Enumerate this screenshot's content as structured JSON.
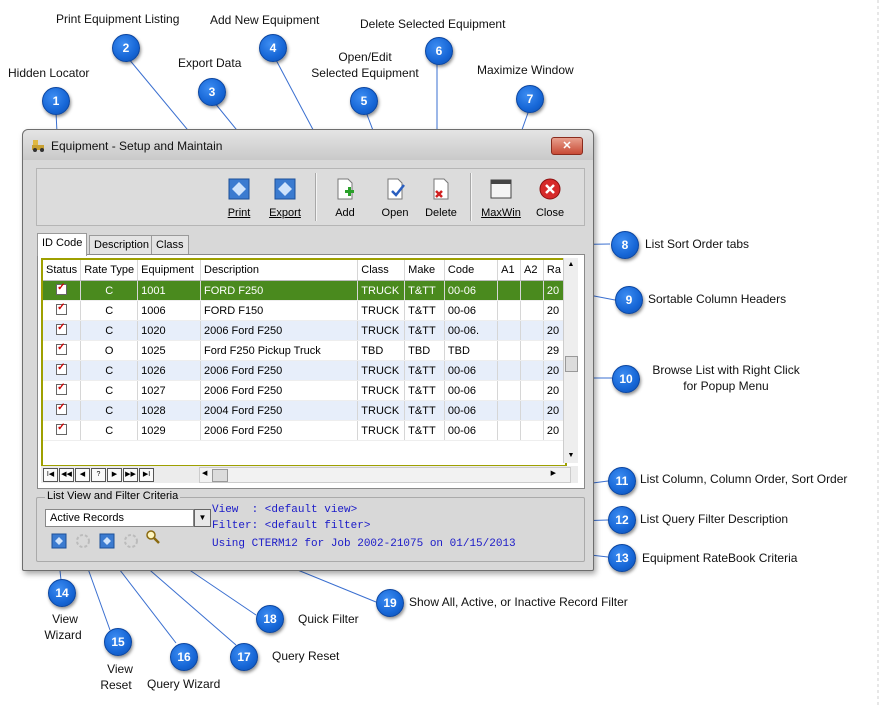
{
  "window": {
    "title": "Equipment - Setup and Maintain",
    "close_glyph": "✕"
  },
  "toolbar": {
    "print": "Print",
    "export": "Export",
    "add": "Add",
    "open": "Open",
    "delete": "Delete",
    "maxwin": "MaxWin",
    "close": "Close"
  },
  "tabs": [
    "ID Code",
    "Description",
    "Class"
  ],
  "grid": {
    "columns": [
      "Status",
      "Rate Type",
      "Equipment",
      "Description",
      "Class",
      "Make",
      "Code",
      "A1",
      "A2",
      "Ra"
    ],
    "rows": [
      {
        "rate": "C",
        "equip": "1001",
        "desc": "FORD F250",
        "class": "TRUCK",
        "make": "T&TT",
        "code": "00-06",
        "ra": "20"
      },
      {
        "rate": "C",
        "equip": "1006",
        "desc": "FORD F150",
        "class": "TRUCK",
        "make": "T&TT",
        "code": "00-06",
        "ra": "20"
      },
      {
        "rate": "C",
        "equip": "1020",
        "desc": "2006 Ford F250",
        "class": "TRUCK",
        "make": "T&TT",
        "code": "00-06.",
        "ra": "20"
      },
      {
        "rate": "O",
        "equip": "1025",
        "desc": "Ford F250 Pickup Truck",
        "class": "TBD",
        "make": "TBD",
        "code": "TBD",
        "ra": "29"
      },
      {
        "rate": "C",
        "equip": "1026",
        "desc": "2006 Ford F250",
        "class": "TRUCK",
        "make": "T&TT",
        "code": "00-06",
        "ra": "20"
      },
      {
        "rate": "C",
        "equip": "1027",
        "desc": "2006 Ford F250",
        "class": "TRUCK",
        "make": "T&TT",
        "code": "00-06",
        "ra": "20"
      },
      {
        "rate": "C",
        "equip": "1028",
        "desc": "2004 Ford F250",
        "class": "TRUCK",
        "make": "T&TT",
        "code": "00-06",
        "ra": "20"
      },
      {
        "rate": "C",
        "equip": "1029",
        "desc": "2006 Ford F250",
        "class": "TRUCK",
        "make": "T&TT",
        "code": "00-06",
        "ra": "20"
      }
    ]
  },
  "navbar": [
    "I◀",
    "◀◀",
    "◀",
    "?",
    "▶",
    "▶▶",
    "▶I"
  ],
  "filter": {
    "legend": "List View and Filter Criteria",
    "dropdown_value": "Active Records",
    "view_text": "View  : <default view>",
    "filter_text": "Filter: <default filter>",
    "ratebook_text": "Using CTERM12 for Job 2002-21075 on 01/15/2013"
  },
  "callouts": {
    "c1": {
      "num": "1",
      "label": "Hidden Locator"
    },
    "c2": {
      "num": "2",
      "label": "Print Equipment Listing"
    },
    "c3": {
      "num": "3",
      "label": "Export Data"
    },
    "c4": {
      "num": "4",
      "label": "Add New Equipment"
    },
    "c5": {
      "num": "5",
      "label1": "Open/Edit",
      "label2": "Selected Equipment"
    },
    "c6": {
      "num": "6",
      "label": "Delete Selected Equipment"
    },
    "c7": {
      "num": "7",
      "label": "Maximize Window"
    },
    "c8": {
      "num": "8",
      "label": "List Sort Order tabs"
    },
    "c9": {
      "num": "9",
      "label": "Sortable Column Headers"
    },
    "c10": {
      "num": "10",
      "label1": "Browse List with Right Click",
      "label2": "for Popup Menu"
    },
    "c11": {
      "num": "11",
      "label": "List Column, Column Order, Sort Order"
    },
    "c12": {
      "num": "12",
      "label": "List Query Filter Description"
    },
    "c13": {
      "num": "13",
      "label": "Equipment RateBook Criteria"
    },
    "c14": {
      "num": "14",
      "label1": "View",
      "label2": "Wizard"
    },
    "c15": {
      "num": "15",
      "label1": "View",
      "label2": "Reset"
    },
    "c16": {
      "num": "16",
      "label": "Query Wizard"
    },
    "c17": {
      "num": "17",
      "label": "Query Reset"
    },
    "c18": {
      "num": "18",
      "label": "Quick Filter"
    },
    "c19": {
      "num": "19",
      "label": "Show All, Active, or Inactive Record Filter"
    }
  }
}
